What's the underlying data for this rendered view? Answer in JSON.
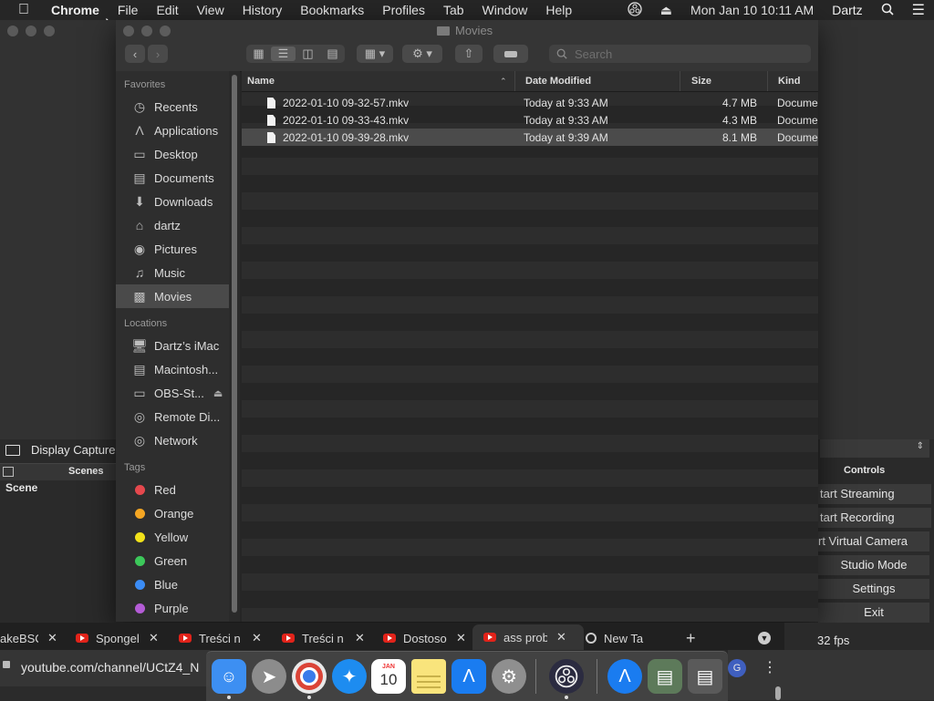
{
  "menubar": {
    "app": "Chrome",
    "items": [
      "File",
      "Edit",
      "View",
      "History",
      "Bookmarks",
      "Profiles",
      "Tab",
      "Window",
      "Help"
    ],
    "datetime": "Mon Jan 10  10:11 AM",
    "user": "Dartz"
  },
  "finder": {
    "title": "Movies",
    "search_placeholder": "Search",
    "sidebar": {
      "favorites_label": "Favorites",
      "favorites": [
        {
          "label": "Recents",
          "icon": "clock-icon"
        },
        {
          "label": "Applications",
          "icon": "applications-icon"
        },
        {
          "label": "Desktop",
          "icon": "desktop-icon"
        },
        {
          "label": "Documents",
          "icon": "documents-icon"
        },
        {
          "label": "Downloads",
          "icon": "downloads-icon"
        },
        {
          "label": "dartz",
          "icon": "home-icon"
        },
        {
          "label": "Pictures",
          "icon": "camera-icon"
        },
        {
          "label": "Music",
          "icon": "music-icon"
        },
        {
          "label": "Movies",
          "icon": "film-icon"
        }
      ],
      "locations_label": "Locations",
      "locations": [
        {
          "label": "Dartz’s iMac",
          "icon": "imac-icon"
        },
        {
          "label": "Macintosh...",
          "icon": "disk-icon"
        },
        {
          "label": "OBS-St...",
          "icon": "disk-icon"
        },
        {
          "label": "Remote Di...",
          "icon": "disc-icon"
        },
        {
          "label": "Network",
          "icon": "globe-icon"
        }
      ],
      "tags_label": "Tags",
      "tags": [
        {
          "label": "Red",
          "color": "#e5484d"
        },
        {
          "label": "Orange",
          "color": "#f5a623"
        },
        {
          "label": "Yellow",
          "color": "#f2e21a"
        },
        {
          "label": "Green",
          "color": "#3cc85a"
        },
        {
          "label": "Blue",
          "color": "#3b8cf5"
        },
        {
          "label": "Purple",
          "color": "#b45cd6"
        }
      ]
    },
    "columns": {
      "name": "Name",
      "date": "Date Modified",
      "size": "Size",
      "kind": "Kind"
    },
    "files": [
      {
        "name": "2022-01-10 09-32-57.mkv",
        "date": "Today at 9:33 AM",
        "size": "4.7 MB",
        "kind": "Docume"
      },
      {
        "name": "2022-01-10 09-33-43.mkv",
        "date": "Today at 9:33 AM",
        "size": "4.3 MB",
        "kind": "Docume"
      },
      {
        "name": "2022-01-10 09-39-28.mkv",
        "date": "Today at 9:39 AM",
        "size": "8.1 MB",
        "kind": "Docume"
      }
    ]
  },
  "obs": {
    "source": "Display Capture",
    "scenes_label": "Scenes",
    "scene": "Scene",
    "controls_label": "Controls",
    "buttons": [
      "tart Streaming",
      "tart Recording",
      "rt Virtual Camera",
      "Studio Mode",
      "Settings",
      "Exit"
    ],
    "fps": "32 fps"
  },
  "chrome": {
    "tabs": [
      "akeBSC",
      "Spongel",
      "Treści n",
      "Treści n",
      "Dostoso",
      "ass prob",
      "New Tal"
    ],
    "url": "youtube.com/channel/UCtZ4_N",
    "profile_initial": "G"
  },
  "calendar": {
    "month": "JAN",
    "day": "10"
  }
}
